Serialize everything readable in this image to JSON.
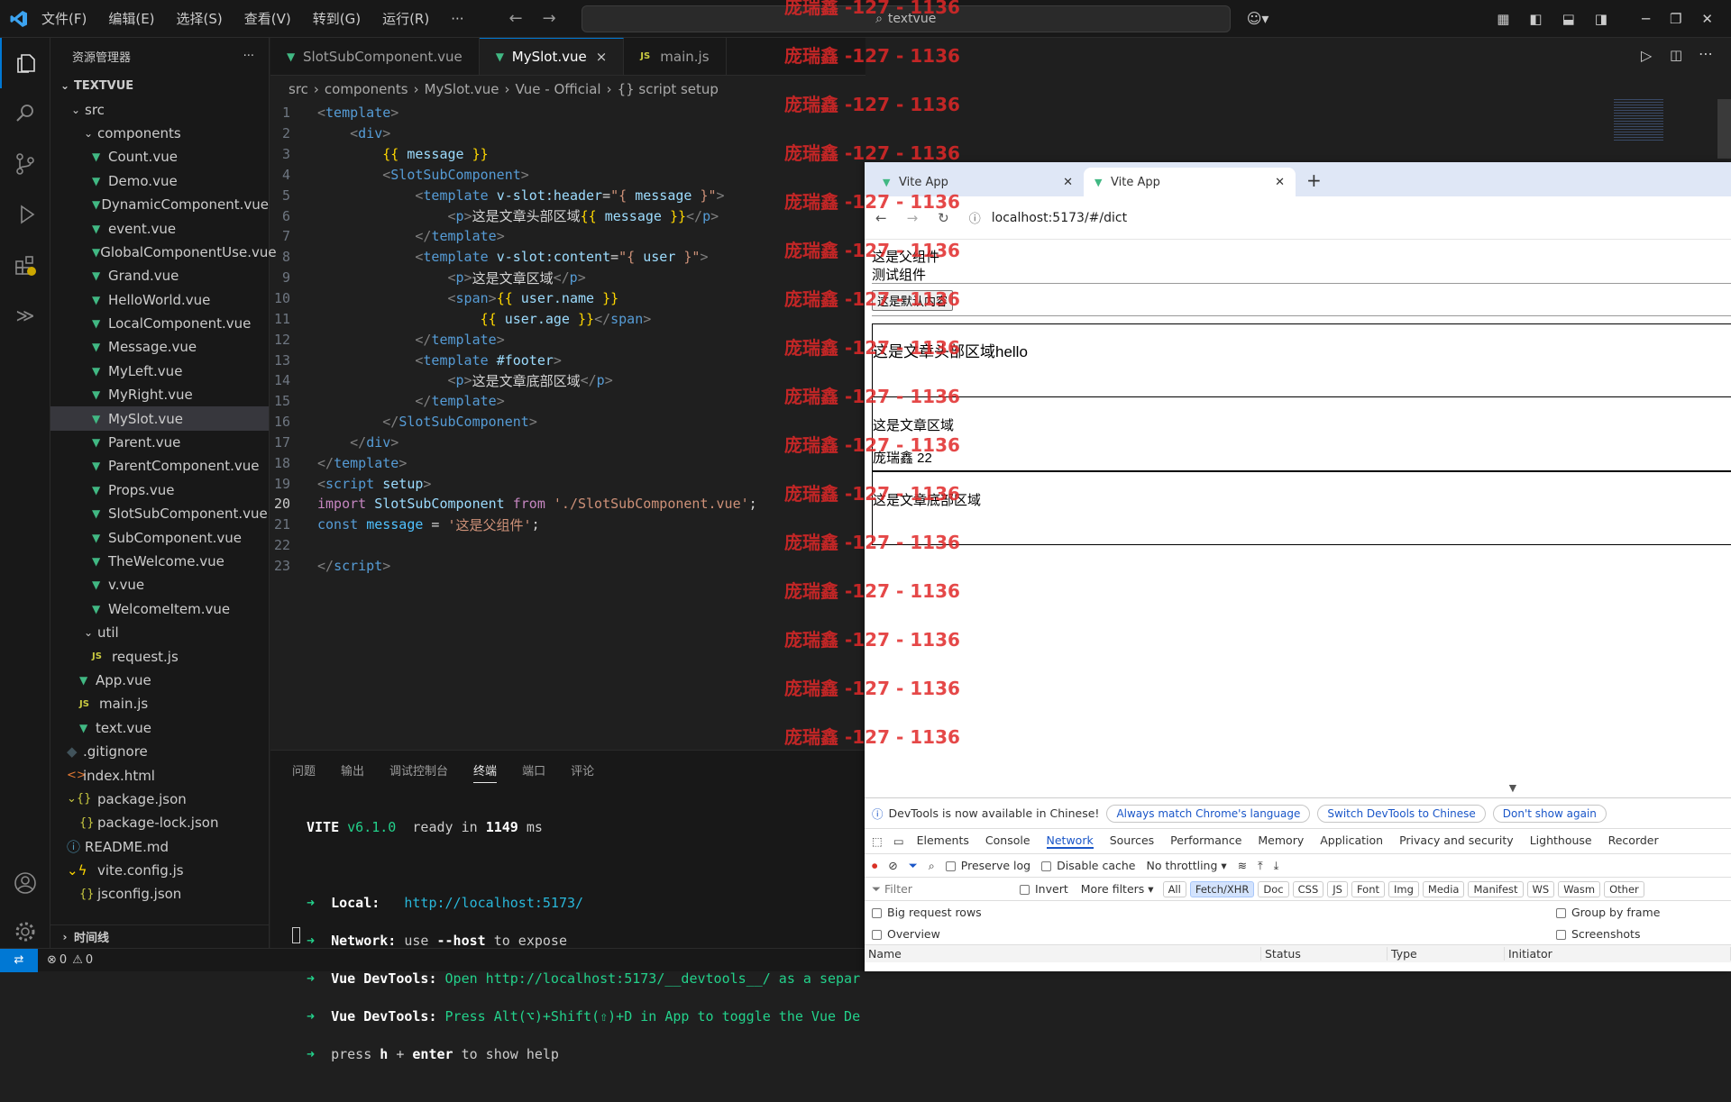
{
  "titlebar": {
    "menus": [
      "文件(F)",
      "编辑(E)",
      "选择(S)",
      "查看(V)",
      "转到(G)",
      "运行(R)"
    ],
    "more": "···",
    "search": "textvue"
  },
  "explorer": {
    "title": "资源管理器",
    "root": "TEXTVUE",
    "outline": "时间线",
    "items": [
      {
        "label": "src",
        "kind": "folder",
        "indent": 0
      },
      {
        "label": "components",
        "kind": "folder",
        "indent": 1
      },
      {
        "label": "Count.vue",
        "kind": "vue",
        "indent": 2
      },
      {
        "label": "Demo.vue",
        "kind": "vue",
        "indent": 2
      },
      {
        "label": "DynamicComponent.vue",
        "kind": "vue",
        "indent": 2
      },
      {
        "label": "event.vue",
        "kind": "vue",
        "indent": 2
      },
      {
        "label": "GlobalComponentUse.vue",
        "kind": "vue",
        "indent": 2
      },
      {
        "label": "Grand.vue",
        "kind": "vue",
        "indent": 2
      },
      {
        "label": "HelloWorld.vue",
        "kind": "vue",
        "indent": 2
      },
      {
        "label": "LocalComponent.vue",
        "kind": "vue",
        "indent": 2
      },
      {
        "label": "Message.vue",
        "kind": "vue",
        "indent": 2
      },
      {
        "label": "MyLeft.vue",
        "kind": "vue",
        "indent": 2
      },
      {
        "label": "MyRight.vue",
        "kind": "vue",
        "indent": 2
      },
      {
        "label": "MySlot.vue",
        "kind": "vue",
        "indent": 2,
        "selected": true
      },
      {
        "label": "Parent.vue",
        "kind": "vue",
        "indent": 2
      },
      {
        "label": "ParentComponent.vue",
        "kind": "vue",
        "indent": 2
      },
      {
        "label": "Props.vue",
        "kind": "vue",
        "indent": 2
      },
      {
        "label": "SlotSubComponent.vue",
        "kind": "vue",
        "indent": 2
      },
      {
        "label": "SubComponent.vue",
        "kind": "vue",
        "indent": 2
      },
      {
        "label": "TheWelcome.vue",
        "kind": "vue",
        "indent": 2
      },
      {
        "label": "v.vue",
        "kind": "vue",
        "indent": 2
      },
      {
        "label": "WelcomeItem.vue",
        "kind": "vue",
        "indent": 2
      },
      {
        "label": "util",
        "kind": "folder",
        "indent": 1
      },
      {
        "label": "request.js",
        "kind": "js",
        "indent": 2
      },
      {
        "label": "App.vue",
        "kind": "vue",
        "indent": 1
      },
      {
        "label": "main.js",
        "kind": "js",
        "indent": 1
      },
      {
        "label": "text.vue",
        "kind": "vue",
        "indent": 1
      },
      {
        "label": ".gitignore",
        "kind": "git",
        "indent": 0
      },
      {
        "label": "index.html",
        "kind": "html",
        "indent": 0
      },
      {
        "label": "package.json",
        "kind": "jsonfolder",
        "indent": 0
      },
      {
        "label": "package-lock.json",
        "kind": "json",
        "indent": 1
      },
      {
        "label": "README.md",
        "kind": "info",
        "indent": 0
      },
      {
        "label": "vite.config.js",
        "kind": "cfgfolder",
        "indent": 0
      },
      {
        "label": "jsconfig.json",
        "kind": "json",
        "indent": 1
      }
    ]
  },
  "editor": {
    "tabs": [
      {
        "label": "SlotSubComponent.vue",
        "icon": "vue"
      },
      {
        "label": "MySlot.vue",
        "icon": "vue",
        "active": true,
        "close": "×"
      },
      {
        "label": "main.js",
        "icon": "js"
      }
    ],
    "breadcrumb": [
      "src",
      "components",
      "MySlot.vue",
      "Vue - Official",
      "{} script setup"
    ],
    "current_line": 20
  },
  "code_lines": [
    [
      [
        "t",
        "<"
      ],
      [
        "tg",
        "template"
      ],
      [
        "t",
        ">"
      ]
    ],
    [
      [
        "sp",
        "    "
      ],
      [
        "t",
        "<"
      ],
      [
        "tg",
        "div"
      ],
      [
        "t",
        ">"
      ]
    ],
    [
      [
        "sp",
        "        "
      ],
      [
        "br",
        "{{"
      ],
      [
        "tx",
        " "
      ],
      [
        "ident",
        "message"
      ],
      [
        "tx",
        " "
      ],
      [
        "br",
        "}}"
      ]
    ],
    [
      [
        "sp",
        "        "
      ],
      [
        "t",
        "<"
      ],
      [
        "tg",
        "SlotSubComponent"
      ],
      [
        "t",
        ">"
      ]
    ],
    [
      [
        "sp",
        "            "
      ],
      [
        "t",
        "<"
      ],
      [
        "tg",
        "template"
      ],
      [
        "tx",
        " "
      ],
      [
        "at",
        "v-slot:header"
      ],
      [
        "tx",
        "="
      ],
      [
        "st",
        "\"{ "
      ],
      [
        "ident",
        "message"
      ],
      [
        "st",
        " }\""
      ],
      [
        "t",
        ">"
      ]
    ],
    [
      [
        "sp",
        "                "
      ],
      [
        "t",
        "<"
      ],
      [
        "tg",
        "p"
      ],
      [
        "t",
        ">"
      ],
      [
        "tx",
        "这是文章头部区域"
      ],
      [
        "br",
        "{{"
      ],
      [
        "tx",
        " "
      ],
      [
        "ident",
        "message"
      ],
      [
        "tx",
        " "
      ],
      [
        "br",
        "}}"
      ],
      [
        "t",
        "</"
      ],
      [
        "tg",
        "p"
      ],
      [
        "t",
        ">"
      ]
    ],
    [
      [
        "sp",
        "            "
      ],
      [
        "t",
        "</"
      ],
      [
        "tg",
        "template"
      ],
      [
        "t",
        ">"
      ]
    ],
    [
      [
        "sp",
        "            "
      ],
      [
        "t",
        "<"
      ],
      [
        "tg",
        "template"
      ],
      [
        "tx",
        " "
      ],
      [
        "at",
        "v-slot:content"
      ],
      [
        "tx",
        "="
      ],
      [
        "st",
        "\"{ "
      ],
      [
        "ident",
        "user"
      ],
      [
        "st",
        " }\""
      ],
      [
        "t",
        ">"
      ]
    ],
    [
      [
        "sp",
        "                "
      ],
      [
        "t",
        "<"
      ],
      [
        "tg",
        "p"
      ],
      [
        "t",
        ">"
      ],
      [
        "tx",
        "这是文章区域"
      ],
      [
        "t",
        "</"
      ],
      [
        "tg",
        "p"
      ],
      [
        "t",
        ">"
      ]
    ],
    [
      [
        "sp",
        "                "
      ],
      [
        "t",
        "<"
      ],
      [
        "tg",
        "span"
      ],
      [
        "t",
        ">"
      ],
      [
        "br",
        "{{"
      ],
      [
        "tx",
        " "
      ],
      [
        "ident",
        "user.name"
      ],
      [
        "tx",
        " "
      ],
      [
        "br",
        "}}"
      ]
    ],
    [
      [
        "sp",
        "                    "
      ],
      [
        "br",
        "{{"
      ],
      [
        "tx",
        " "
      ],
      [
        "ident",
        "user.age"
      ],
      [
        "tx",
        " "
      ],
      [
        "br",
        "}}"
      ],
      [
        "t",
        "</"
      ],
      [
        "tg",
        "span"
      ],
      [
        "t",
        ">"
      ]
    ],
    [
      [
        "sp",
        "            "
      ],
      [
        "t",
        "</"
      ],
      [
        "tg",
        "template"
      ],
      [
        "t",
        ">"
      ]
    ],
    [
      [
        "sp",
        "            "
      ],
      [
        "t",
        "<"
      ],
      [
        "tg",
        "template"
      ],
      [
        "tx",
        " "
      ],
      [
        "at",
        "#footer"
      ],
      [
        "t",
        ">"
      ]
    ],
    [
      [
        "sp",
        "                "
      ],
      [
        "t",
        "<"
      ],
      [
        "tg",
        "p"
      ],
      [
        "t",
        ">"
      ],
      [
        "tx",
        "这是文章底部区域"
      ],
      [
        "t",
        "</"
      ],
      [
        "tg",
        "p"
      ],
      [
        "t",
        ">"
      ]
    ],
    [
      [
        "sp",
        "            "
      ],
      [
        "t",
        "</"
      ],
      [
        "tg",
        "template"
      ],
      [
        "t",
        ">"
      ]
    ],
    [
      [
        "sp",
        "        "
      ],
      [
        "t",
        "</"
      ],
      [
        "tg",
        "SlotSubComponent"
      ],
      [
        "t",
        ">"
      ]
    ],
    [
      [
        "sp",
        "    "
      ],
      [
        "t",
        "</"
      ],
      [
        "tg",
        "div"
      ],
      [
        "t",
        ">"
      ]
    ],
    [
      [
        "t",
        "</"
      ],
      [
        "tg",
        "template"
      ],
      [
        "t",
        ">"
      ]
    ],
    [
      [
        "t",
        "<"
      ],
      [
        "tg",
        "script"
      ],
      [
        "tx",
        " "
      ],
      [
        "at",
        "setup"
      ],
      [
        "t",
        ">"
      ]
    ],
    [
      [
        "kw",
        "import"
      ],
      [
        "tx",
        " "
      ],
      [
        "ident",
        "SlotSubComponent"
      ],
      [
        "tx",
        " "
      ],
      [
        "kw",
        "from"
      ],
      [
        "tx",
        " "
      ],
      [
        "st",
        "'./SlotSubComponent.vue'"
      ],
      [
        "tx",
        ";"
      ]
    ],
    [
      [
        "tg",
        "const"
      ],
      [
        "tx",
        " "
      ],
      [
        "cv",
        "message"
      ],
      [
        "tx",
        " = "
      ],
      [
        "st",
        "'这是父组件'"
      ],
      [
        "tx",
        ";"
      ]
    ],
    [],
    [
      [
        "t",
        "</"
      ],
      [
        "tg",
        "script"
      ],
      [
        "t",
        ">"
      ]
    ]
  ],
  "panel": {
    "tabs": [
      "问题",
      "输出",
      "调试控制台",
      "终端",
      "端口",
      "评论"
    ],
    "active": "终端",
    "terminal": {
      "vite_name": "VITE",
      "vite_version": "v6.1.0",
      "ready_prefix": "ready in",
      "ready_ms": "1149",
      "ready_suffix": "ms",
      "local_label": "Local:",
      "local_url": "http://localhost:5173/",
      "network_label": "Network:",
      "network_prefix": "use",
      "network_flag": "--host",
      "network_suffix": "to expose",
      "devtools_label": "Vue DevTools:",
      "devtools_open_text": "Open http://localhost:5173/__devtools__/ as a separ",
      "devtools_press_text": "Press Alt(⌥)+Shift(⇧)+D in App to toggle the Vue De",
      "help_prefix": "press",
      "help_h": "h",
      "help_plus": "+",
      "help_enter": "enter",
      "help_suffix": "to show help"
    }
  },
  "statusbar": {
    "errors": "0",
    "warnings": "0"
  },
  "watermark": "庞瑞鑫 -127 - 1136",
  "browser": {
    "tabs": [
      {
        "label": "Vite App"
      },
      {
        "label": "Vite App",
        "active": true
      }
    ],
    "new_tab": "+",
    "address": "localhost:5173/#/dict",
    "page": {
      "line1": "这是父组件",
      "line2": "测试组件",
      "button": "这是默认内容",
      "header": "这是文章头部区域hello",
      "content": "这是文章区域",
      "user": "庞瑞鑫 22",
      "footer": "这是文章底部区域"
    },
    "devtools": {
      "notice": "DevTools is now available in Chinese!",
      "notice_buttons": [
        "Always match Chrome's language",
        "Switch DevTools to Chinese",
        "Don't show again"
      ],
      "tabs": [
        "Elements",
        "Console",
        "Network",
        "Sources",
        "Performance",
        "Memory",
        "Application",
        "Privacy and security",
        "Lighthouse",
        "Recorder"
      ],
      "active_tab": "Network",
      "preserve_log": "Preserve log",
      "disable_cache": "Disable cache",
      "throttling": "No throttling",
      "filter_placeholder": "Filter",
      "invert": "Invert",
      "more_filters": "More filters",
      "filter_chips": [
        "All",
        "Fetch/XHR",
        "Doc",
        "CSS",
        "JS",
        "Font",
        "Img",
        "Media",
        "Manifest",
        "WS",
        "Wasm",
        "Other"
      ],
      "active_chip": "Fetch/XHR",
      "big_rows": "Big request rows",
      "group_by_frame": "Group by frame",
      "overview": "Overview",
      "screenshots": "Screenshots",
      "columns": [
        "Name",
        "Status",
        "Type",
        "Initiator"
      ]
    }
  }
}
